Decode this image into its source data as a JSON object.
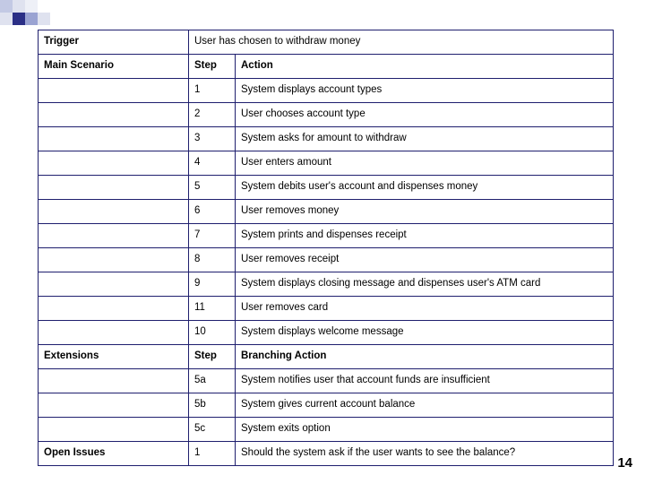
{
  "page": {
    "number": "14"
  },
  "table": {
    "rows": [
      {
        "label": "Trigger",
        "label_bold": true,
        "step": "",
        "action": "User has chosen to withdraw money",
        "action_span": true,
        "action_bold": false
      },
      {
        "label": "Main Scenario",
        "label_bold": true,
        "step": "Step",
        "action": "Action",
        "action_span": false,
        "action_bold": true
      },
      {
        "label": "",
        "label_bold": false,
        "step": "1",
        "action": "System displays account types",
        "action_span": false,
        "action_bold": false
      },
      {
        "label": "",
        "label_bold": false,
        "step": "2",
        "action": "User chooses account type",
        "action_span": false,
        "action_bold": false
      },
      {
        "label": "",
        "label_bold": false,
        "step": "3",
        "action": "System asks for amount to withdraw",
        "action_span": false,
        "action_bold": false
      },
      {
        "label": "",
        "label_bold": false,
        "step": "4",
        "action": "User enters amount",
        "action_span": false,
        "action_bold": false
      },
      {
        "label": "",
        "label_bold": false,
        "step": "5",
        "action": "System debits user's account and dispenses money",
        "action_span": false,
        "action_bold": false
      },
      {
        "label": "",
        "label_bold": false,
        "step": "6",
        "action": "User removes money",
        "action_span": false,
        "action_bold": false
      },
      {
        "label": "",
        "label_bold": false,
        "step": "7",
        "action": "System prints and dispenses receipt",
        "action_span": false,
        "action_bold": false
      },
      {
        "label": "",
        "label_bold": false,
        "step": "8",
        "action": "User removes receipt",
        "action_span": false,
        "action_bold": false
      },
      {
        "label": "",
        "label_bold": false,
        "step": "9",
        "action": "System displays closing message and dispenses user's ATM card",
        "action_span": false,
        "action_bold": false
      },
      {
        "label": "",
        "label_bold": false,
        "step": "11",
        "action": "User removes card",
        "action_span": false,
        "action_bold": false
      },
      {
        "label": "",
        "label_bold": false,
        "step": "10",
        "action": "System displays welcome message",
        "action_span": false,
        "action_bold": false
      },
      {
        "label": "Extensions",
        "label_bold": true,
        "step": "Step",
        "action": "Branching Action",
        "action_span": false,
        "action_bold": true
      },
      {
        "label": "",
        "label_bold": false,
        "step": "5a",
        "action": "System notifies user that account funds are insufficient",
        "action_span": false,
        "action_bold": false
      },
      {
        "label": "",
        "label_bold": false,
        "step": "5b",
        "action": "System gives current account balance",
        "action_span": false,
        "action_bold": false
      },
      {
        "label": "",
        "label_bold": false,
        "step": "5c",
        "action": "System exits option",
        "action_span": false,
        "action_bold": false
      },
      {
        "label": "Open Issues",
        "label_bold": true,
        "step": "1",
        "action": "Should the system ask if the user wants to see the balance?",
        "action_span": false,
        "action_bold": false
      }
    ]
  }
}
